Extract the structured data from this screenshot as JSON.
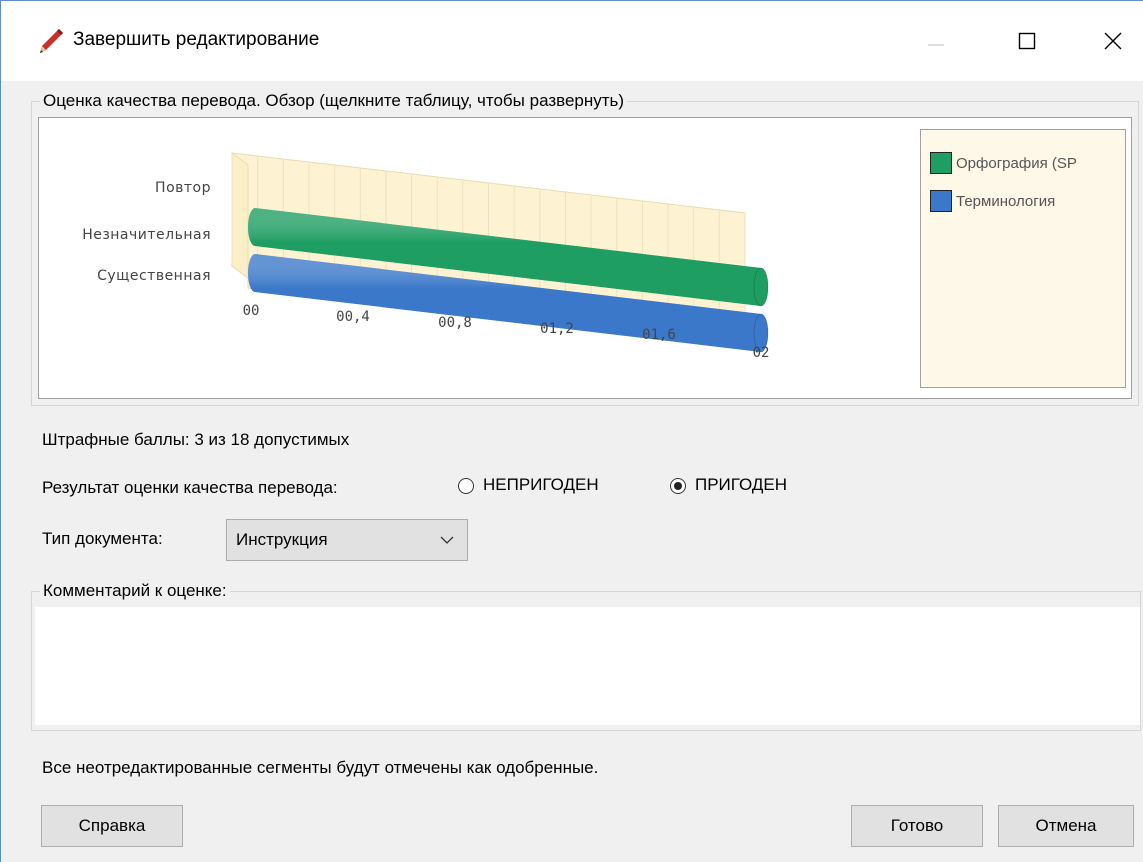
{
  "window": {
    "title": "Завершить редактирование",
    "icon": "pencil-icon"
  },
  "qa_group": {
    "legend": "Оценка качества перевода. Обзор (щелкните таблицу, чтобы развернуть)"
  },
  "chart_data": {
    "type": "bar",
    "orientation": "horizontal",
    "style": "3d-cylinder",
    "categories": [
      "Повтор",
      "Незначительная",
      "Существенная"
    ],
    "x_ticks": [
      "00",
      "00,4",
      "00,8",
      "01,2",
      "01,6",
      "02"
    ],
    "xlim": [
      0,
      2
    ],
    "grid": true,
    "legend_position": "right",
    "series": [
      {
        "name": "Орфография (SP",
        "color": "#1e9e62",
        "values": [
          0,
          2,
          0
        ]
      },
      {
        "name": "Терминология",
        "color": "#3b78c9",
        "values": [
          0,
          0,
          2
        ]
      }
    ]
  },
  "penalty_text": "Штрафные баллы: 3 из 18 допустимых",
  "qa_result": {
    "label": "Результат оценки качества перевода:",
    "options": [
      {
        "label": "НЕПРИГОДЕН",
        "checked": false
      },
      {
        "label": "ПРИГОДЕН",
        "checked": true
      }
    ]
  },
  "doc_type": {
    "label": "Тип документа:",
    "value": "Инструкция"
  },
  "comment": {
    "legend": "Комментарий к оценке:",
    "value": ""
  },
  "footer_note": "Все неотредактированные сегменты будут отмечены как одобренные.",
  "buttons": {
    "help": "Справка",
    "done": "Готово",
    "cancel": "Отмена"
  }
}
